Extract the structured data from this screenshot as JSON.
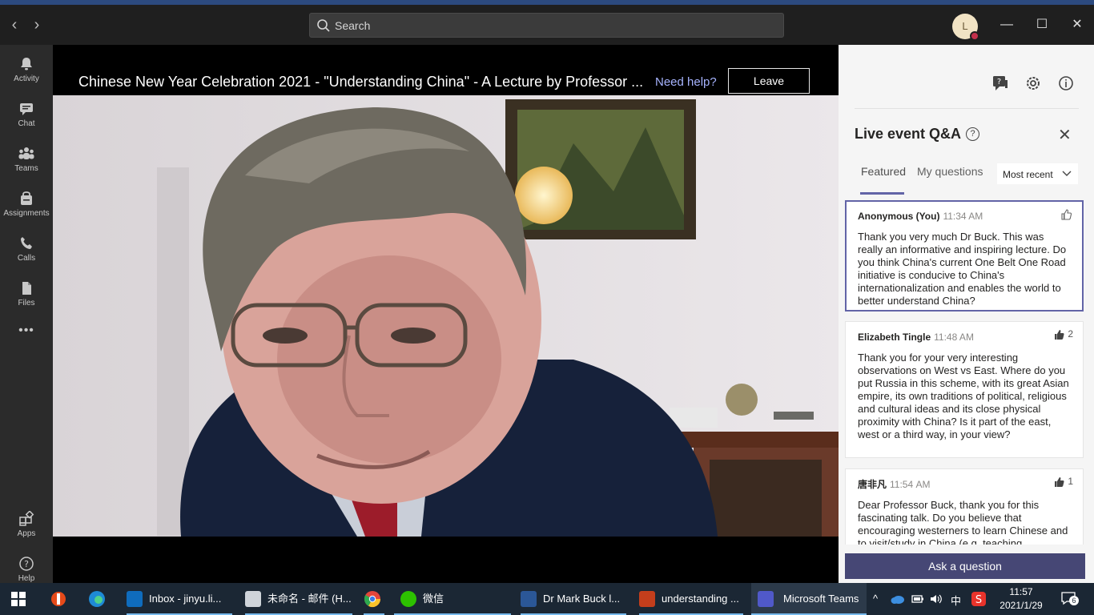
{
  "titlebar": {
    "search_placeholder": "Search",
    "avatar_initial": "L",
    "back_glyph": "‹",
    "forward_glyph": "›",
    "minimize_glyph": "—",
    "maximize_glyph": "☐",
    "close_glyph": "✕"
  },
  "rail": {
    "items": [
      {
        "label": "Activity",
        "icon": "bell-icon"
      },
      {
        "label": "Chat",
        "icon": "chat-icon"
      },
      {
        "label": "Teams",
        "icon": "teams-icon"
      },
      {
        "label": "Assignments",
        "icon": "assignments-icon"
      },
      {
        "label": "Calls",
        "icon": "phone-icon"
      },
      {
        "label": "Files",
        "icon": "file-icon"
      }
    ],
    "more": "•••",
    "apps_label": "Apps",
    "help_label": "Help"
  },
  "stage": {
    "title": "Chinese New Year Celebration 2021 - \"Understanding China\" - A Lecture by Professor ...",
    "need_help": "Need help?",
    "leave": "Leave"
  },
  "panel": {
    "title": "Live event Q&A",
    "help_glyph": "?",
    "close_glyph": "✕",
    "tabs": [
      {
        "label": "Featured",
        "active": true
      },
      {
        "label": "My questions",
        "active": false
      }
    ],
    "sort_label": "Most recent",
    "questions": [
      {
        "author": "Anonymous (You)",
        "time": "11:34 AM",
        "likes": "",
        "body": "Thank you very much Dr Buck. This was really an informative and inspiring lecture. Do you think China's current One Belt One Road initiative is conducive to China's internationalization and enables the world to better understand China?"
      },
      {
        "author": "Elizabeth Tingle",
        "time": "11:48 AM",
        "likes": "2",
        "body": "Thank you for your very interesting observations on West vs East. Where do you put Russia in this scheme, with its great Asian empire, its own traditions of political, religious and cultural ideas and its close physical proximity with China? Is it part of the east, west or a third way, in your view?"
      },
      {
        "author": "唐非凡",
        "time": "11:54 AM",
        "likes": "1",
        "body": "Dear Professor Buck, thank you for this fascinating talk. Do you believe that encouraging westerners to learn Chinese and to visit/study in China (e.g. teaching"
      }
    ],
    "ask_button": "Ask a question"
  },
  "taskbar": {
    "items": [
      {
        "label": "Inbox - jinyu.li...",
        "color": "#0f6cbd"
      },
      {
        "label": "未命名 - 邮件 (H...",
        "color": "#cfd4da"
      },
      {
        "label": "",
        "color": "#e3463a"
      },
      {
        "label": "微信",
        "color": "#2dc100"
      },
      {
        "label": "Dr Mark Buck l...",
        "color": "#2b5797"
      },
      {
        "label": "understanding ...",
        "color": "#c43e1c"
      },
      {
        "label": "Microsoft Teams",
        "color": "#5059c9"
      }
    ],
    "ime": "中",
    "time": "11:57",
    "date": "2021/1/29",
    "notifications": "6"
  },
  "colors": {
    "accent": "#6264a7",
    "ask_button": "#464775",
    "need_help": "#a7b4ff"
  }
}
